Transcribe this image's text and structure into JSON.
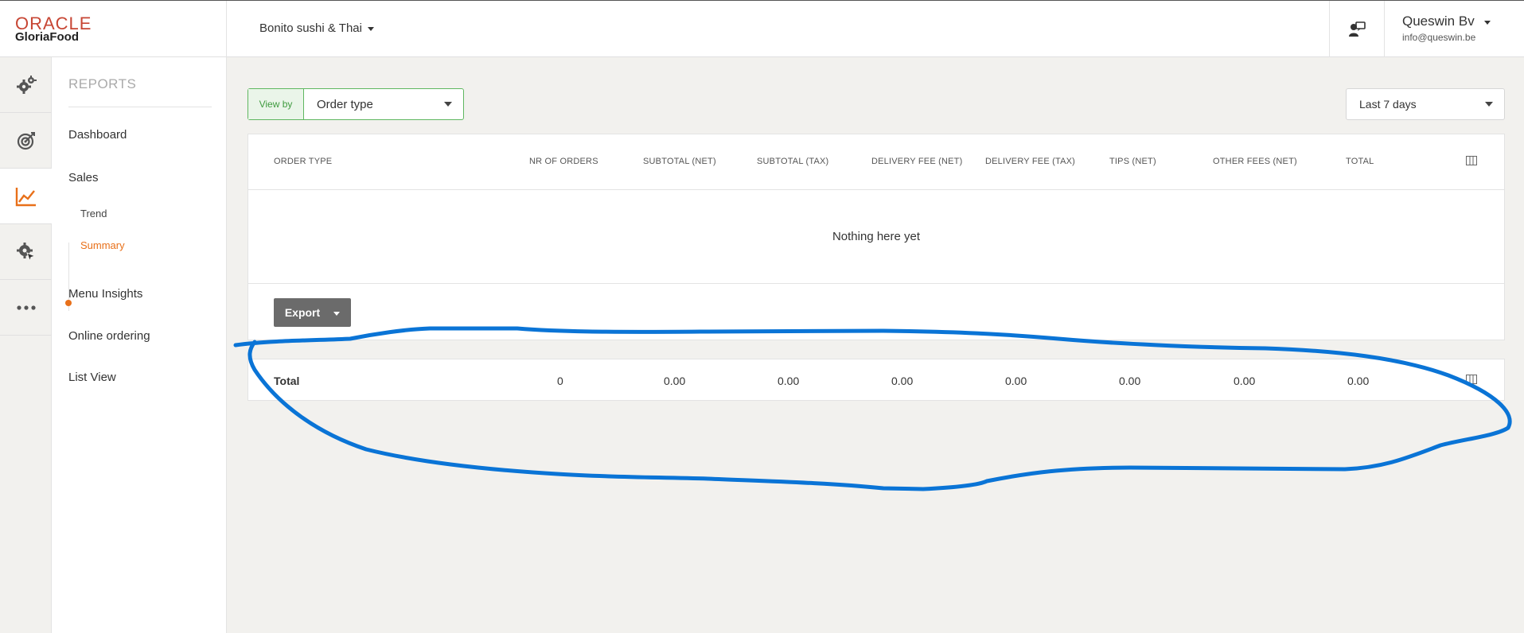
{
  "brand": {
    "oracle": "ORACLE",
    "product": "GloriaFood",
    "oracle_color": "#c74634"
  },
  "header": {
    "restaurant": "Bonito sushi & Thai",
    "user_name": "Queswin Bv",
    "user_email": "info@queswin.be",
    "support_icon": "chat-support-icon"
  },
  "rail": [
    {
      "icon": "gears-icon",
      "active": false
    },
    {
      "icon": "target-icon",
      "active": false
    },
    {
      "icon": "chart-line-icon",
      "active": true
    },
    {
      "icon": "gear-cursor-icon",
      "active": false
    },
    {
      "icon": "more-dots-icon",
      "active": false
    }
  ],
  "subnav": {
    "title": "REPORTS",
    "items": [
      "Dashboard",
      "Sales",
      "Menu Insights",
      "Online ordering",
      "List View"
    ],
    "sales_children": [
      "Trend",
      "Summary"
    ],
    "active_child": "Summary",
    "accent": "#e8701a"
  },
  "filters": {
    "view_by_label": "View by",
    "view_by_value": "Order type",
    "date_range": "Last 7 days",
    "view_by_color": "#5fb760"
  },
  "table": {
    "columns": [
      "ORDER TYPE",
      "NR OF ORDERS",
      "SUBTOTAL (NET)",
      "SUBTOTAL (TAX)",
      "DELIVERY FEE (NET)",
      "DELIVERY FEE (TAX)",
      "TIPS (NET)",
      "OTHER FEES (NET)",
      "TOTAL"
    ],
    "empty_message": "Nothing here yet",
    "export_label": "Export"
  },
  "totals": {
    "label": "Total",
    "values": [
      "0",
      "0.00",
      "0.00",
      "0.00",
      "0.00",
      "0.00",
      "0.00",
      "0.00"
    ]
  },
  "annotation": {
    "color": "#0a74d6"
  }
}
